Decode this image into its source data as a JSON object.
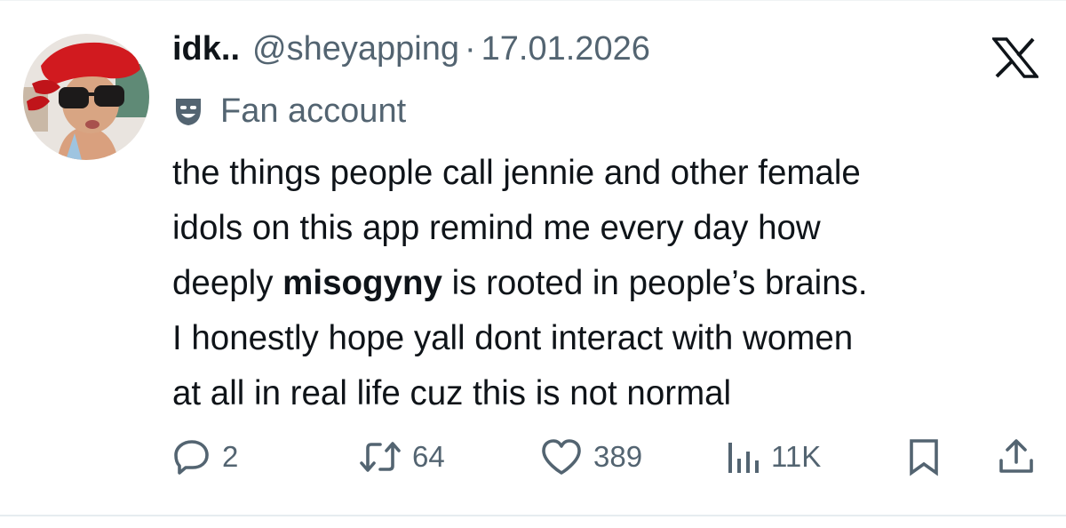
{
  "tweet": {
    "display_name": "idk..",
    "handle": "@sheyapping",
    "separator": "·",
    "date": "17.01.2026",
    "label": "Fan account",
    "text_lines": [
      {
        "before": "the things people call jennie and other female",
        "bold": "",
        "after": ""
      },
      {
        "before": "idols on this app remind me every day how",
        "bold": "",
        "after": ""
      },
      {
        "before": "deeply ",
        "bold": "misogyny",
        "after": " is rooted in people’s brains."
      },
      {
        "before": "I honestly hope yall dont interact with women",
        "bold": "",
        "after": ""
      },
      {
        "before": "at all in real life cuz this is not normal",
        "bold": "",
        "after": ""
      }
    ]
  },
  "metrics": {
    "replies": "2",
    "reposts": "64",
    "likes": "389",
    "views": "11K"
  },
  "icons": {
    "close": "x-logo-icon",
    "label": "theater-masks-icon",
    "reply": "reply-icon",
    "repost": "repost-icon",
    "like": "heart-icon",
    "views": "views-bar-chart-icon",
    "bookmark": "bookmark-icon",
    "share": "share-icon"
  },
  "colors": {
    "text": "#0f1419",
    "muted": "#536471",
    "background": "#ffffff"
  }
}
